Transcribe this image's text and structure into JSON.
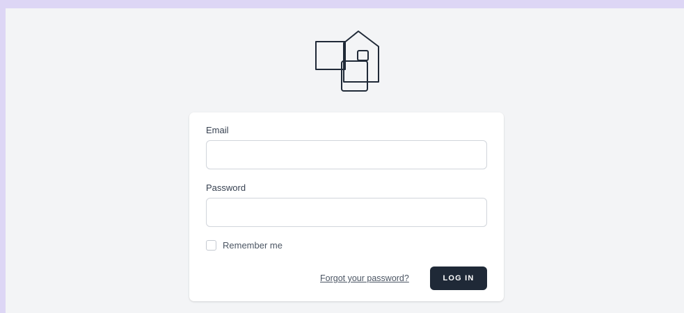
{
  "logo": {
    "icon": "house-logo-icon"
  },
  "form": {
    "email_label": "Email",
    "email_value": "",
    "password_label": "Password",
    "password_value": "",
    "remember_label": "Remember me",
    "remember_checked": false,
    "forgot_link": "Forgot your password?",
    "login_button": "LOG IN"
  },
  "colors": {
    "outer_background": "#ddd6f5",
    "page_background": "#f3f4f6",
    "card_background": "#ffffff",
    "button_background": "#1f2937",
    "button_text": "#ffffff"
  }
}
